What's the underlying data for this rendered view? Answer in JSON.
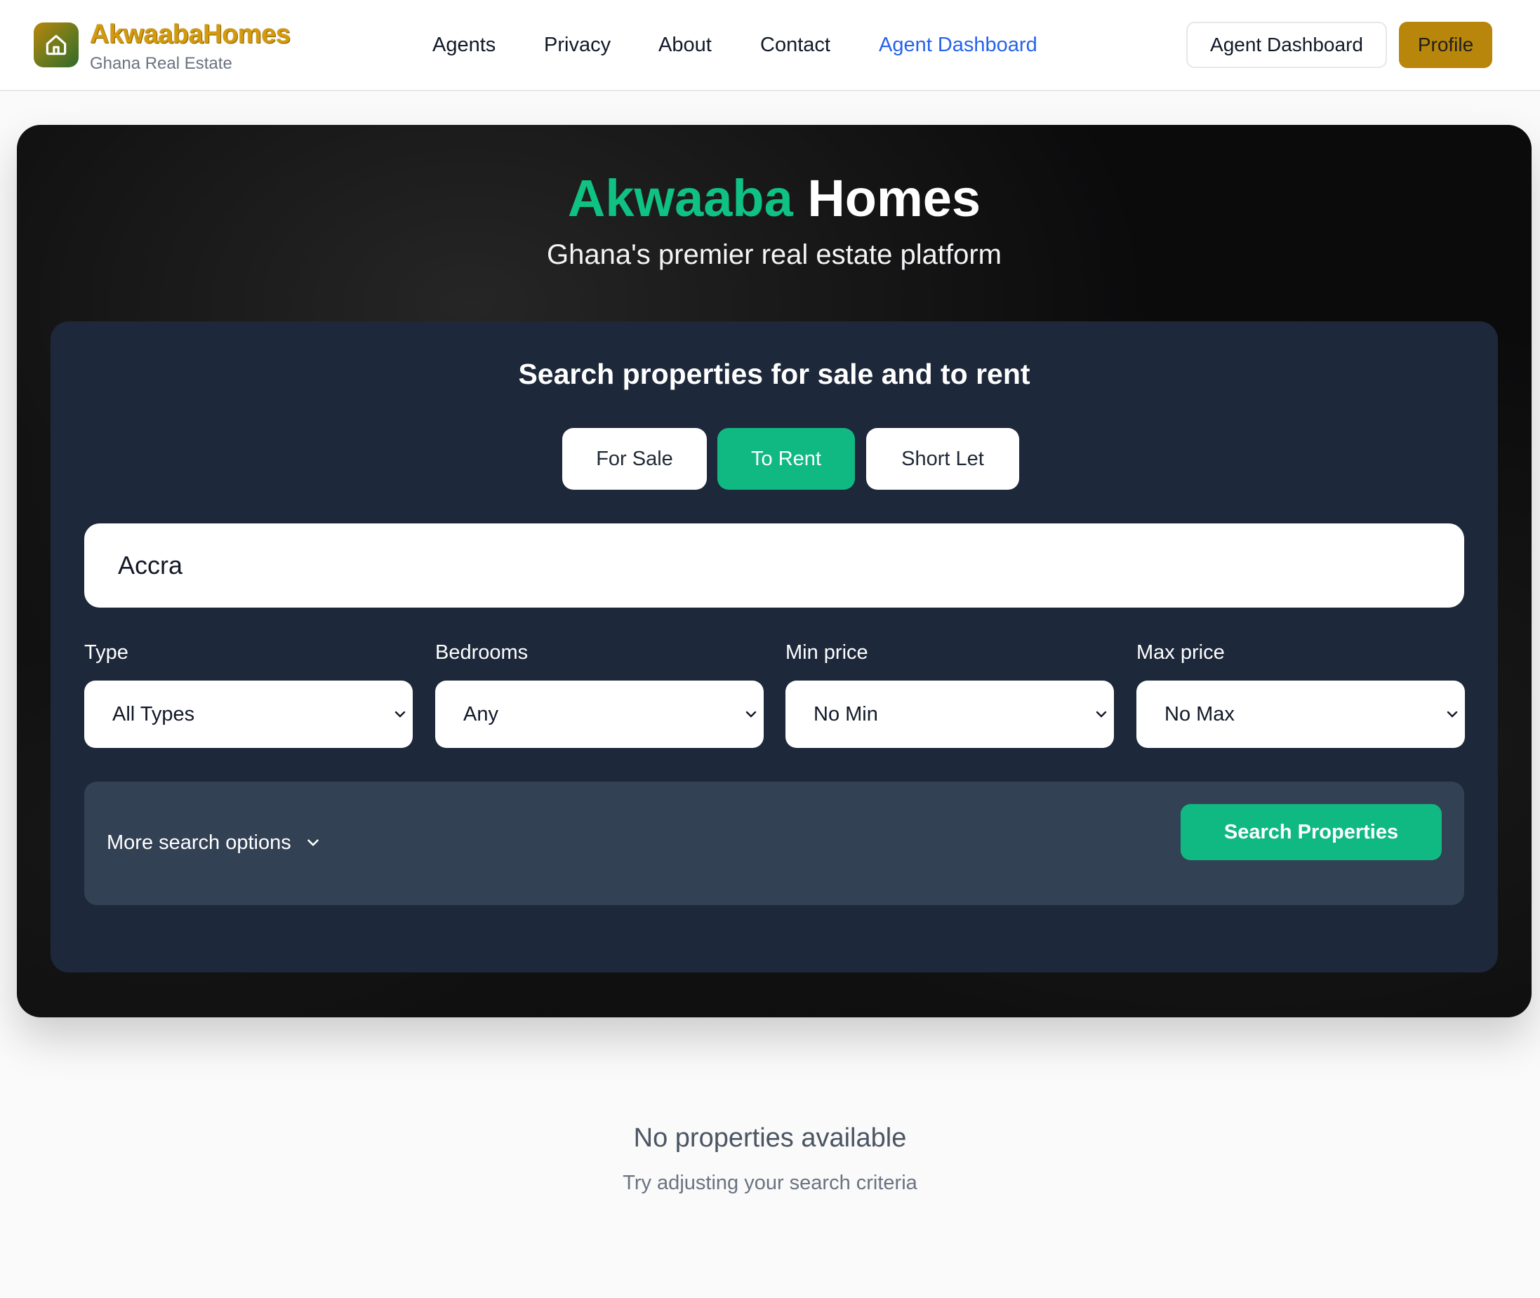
{
  "brand": {
    "name": "AkwaabaHomes",
    "tagline": "Ghana Real Estate",
    "logo_icon": "home-icon",
    "logo_colors": [
      "#b8860b",
      "#2f6b2a"
    ]
  },
  "nav": {
    "items": [
      {
        "label": "Agents",
        "active": false
      },
      {
        "label": "Privacy",
        "active": false
      },
      {
        "label": "About",
        "active": false
      },
      {
        "label": "Contact",
        "active": false
      },
      {
        "label": "Agent Dashboard",
        "active": true
      }
    ],
    "active_color": "#2563eb"
  },
  "header_actions": {
    "dashboard_label": "Agent Dashboard",
    "profile_label": "Profile",
    "profile_color": "#b8860b"
  },
  "hero": {
    "title_accent": "Akwaaba",
    "title_rest": "Homes",
    "subtitle": "Ghana's premier real estate platform",
    "accent_color": "#10c184"
  },
  "search": {
    "title": "Search properties for sale and to rent",
    "tabs": [
      {
        "label": "For Sale",
        "active": false
      },
      {
        "label": "To Rent",
        "active": true
      },
      {
        "label": "Short Let",
        "active": false
      }
    ],
    "location_value": "Accra",
    "filters": [
      {
        "label": "Type",
        "value": "All Types"
      },
      {
        "label": "Bedrooms",
        "value": "Any"
      },
      {
        "label": "Min price",
        "value": "No Min"
      },
      {
        "label": "Max price",
        "value": "No Max"
      }
    ],
    "more_options_label": "More search options",
    "submit_label": "Search Properties",
    "accent_color": "#10b981"
  },
  "empty_state": {
    "title": "No properties available",
    "subtitle": "Try adjusting your search criteria"
  }
}
